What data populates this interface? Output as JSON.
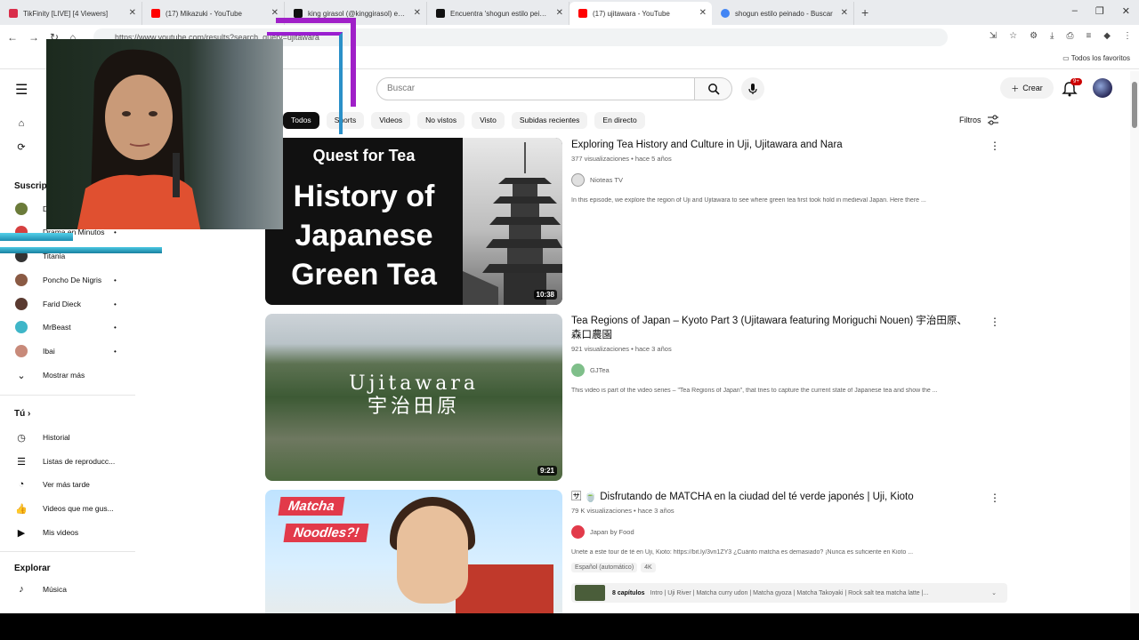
{
  "browser": {
    "tabs": [
      {
        "title": "TikFinity [LIVE] [4 Viewers]",
        "color": "#d92d4a"
      },
      {
        "title": "(17) Mikazuki - YouTube",
        "color": "#ff0000"
      },
      {
        "title": "king girasol (@kinggirasol) está",
        "color": "#111111"
      },
      {
        "title": "Encuentra 'shogun estilo peinad",
        "color": "#111111"
      },
      {
        "title": "(17) ujitawara - YouTube",
        "color": "#ff0000"
      },
      {
        "title": "shogun estilo peinado - Buscar",
        "color": "#4285f4"
      }
    ],
    "new_tab": "+",
    "window_controls": [
      "‒",
      "❐",
      "✕"
    ],
    "url": "https://www.youtube.com/results?search_query=ujitawara",
    "bookmarks_all": "Todos los favoritos"
  },
  "header": {
    "search_placeholder": "Buscar",
    "create_label": "Crear",
    "notif_badge": "9+"
  },
  "chips": [
    "Todos",
    "Shorts",
    "Videos",
    "No vistos",
    "Visto",
    "Subidas recientes",
    "En directo"
  ],
  "filters_label": "Filtros",
  "sidebar": {
    "subs_heading": "Suscripciones",
    "subs": [
      {
        "name": "D",
        "color": "#6b7b3a"
      },
      {
        "name": "Drama en Minutos",
        "color": "#d64040"
      },
      {
        "name": "Titania",
        "color": "#333333"
      },
      {
        "name": "Poncho De Nigris",
        "color": "#8a5a44"
      },
      {
        "name": "Farid Dieck",
        "color": "#5a3a30"
      },
      {
        "name": "MrBeast",
        "color": "#3fb6c8"
      },
      {
        "name": "Ibai",
        "color": "#c88a7a"
      }
    ],
    "show_more": "Mostrar más",
    "you_heading": "Tú",
    "you_items": [
      "Historial",
      "Listas de reproducc...",
      "Ver más tarde",
      "Videos que me gus...",
      "Mis videos"
    ],
    "explore_heading": "Explorar",
    "explore_items": [
      "Música"
    ]
  },
  "results": [
    {
      "title": "Exploring Tea History and Culture in Uji, Ujitawara and Nara",
      "meta": "377 visualizaciones • hace 5 años",
      "channel": "Nioteas TV",
      "desc": "In this episode, we explore the region of Uji and Ujitawara to see where green tea first took hold in medieval Japan. Here there ...",
      "duration": "10:38",
      "thumb_top": "Quest for Tea",
      "thumb_big": "History of Japanese Green Tea"
    },
    {
      "title": "Tea Regions of Japan – Kyoto Part 3 (Ujitawara featuring Moriguchi Nouen) 宇治田原、森口農園",
      "meta": "921 visualizaciones • hace 3 años",
      "channel": "GJTea",
      "desc": "This video is part of the video series – \"Tea Regions of Japan\", that tries to capture the current state of Japanese tea and show the ...",
      "duration": "9:21",
      "thumb_top": "Ujitawara",
      "thumb_big": "宇治田原"
    },
    {
      "title": "🈂 🍵 Disfrutando de MATCHA en la ciudad del té verde japonés | Uji, Kioto",
      "meta": "79 K visualizaciones • hace 3 años",
      "channel": "Japan by Food",
      "desc": "Únete a este tour de té en Uji, Kioto: https://bit.ly/3vn1ZY3 ¿Cuánto matcha es demasiado? ¡Nunca es suficiente en Kioto ...",
      "tag1": "Español (automático)",
      "tag2": "4K",
      "chapters_label": "8 capítulos",
      "chapters_text": "Intro | Uji River | Matcha curry udon | Matcha gyoza | Matcha Takoyaki | Rock salt tea matcha latte |...",
      "thumb_top": "Matcha",
      "thumb_big": "Noodles?!"
    }
  ]
}
